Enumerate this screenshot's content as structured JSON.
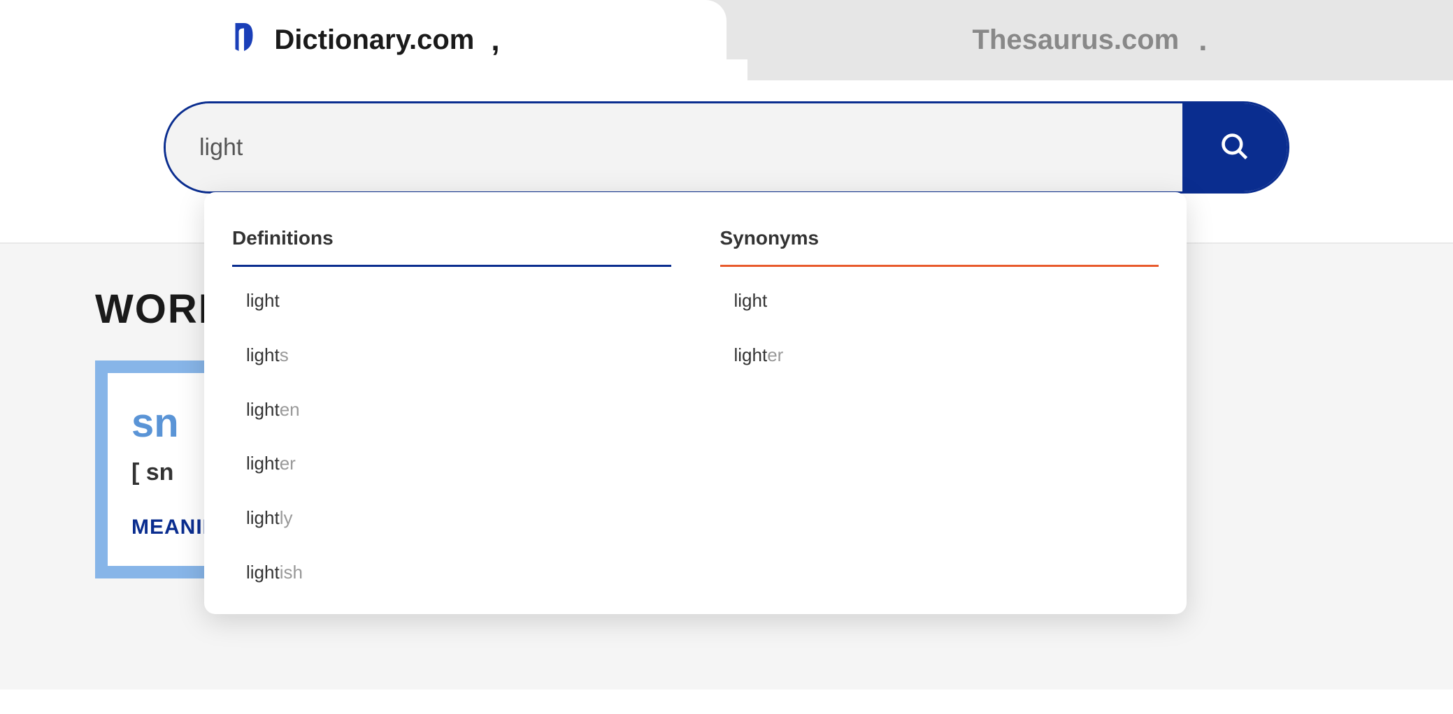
{
  "tabs": {
    "dictionary": "Dictionary.com",
    "thesaurus": "Thesaurus.com"
  },
  "search": {
    "value": "light"
  },
  "dropdown": {
    "definitions_label": "Definitions",
    "synonyms_label": "Synonyms",
    "definitions": [
      {
        "match": "light",
        "rest": ""
      },
      {
        "match": "light",
        "rest": "s"
      },
      {
        "match": "light",
        "rest": "en"
      },
      {
        "match": "light",
        "rest": "er"
      },
      {
        "match": "light",
        "rest": "ly"
      },
      {
        "match": "light",
        "rest": "ish"
      }
    ],
    "synonyms": [
      {
        "match": "light",
        "rest": ""
      },
      {
        "match": "light",
        "rest": "er"
      }
    ]
  },
  "wotd": {
    "heading": "WORD OF THE DAY",
    "word_fragment": "sn",
    "pron_fragment": "[ sn",
    "meaning_fragment": "MEANING"
  },
  "colors": {
    "primary": "#0a2d8f",
    "accent": "#e85a2c",
    "card_border": "#87b5e8"
  }
}
